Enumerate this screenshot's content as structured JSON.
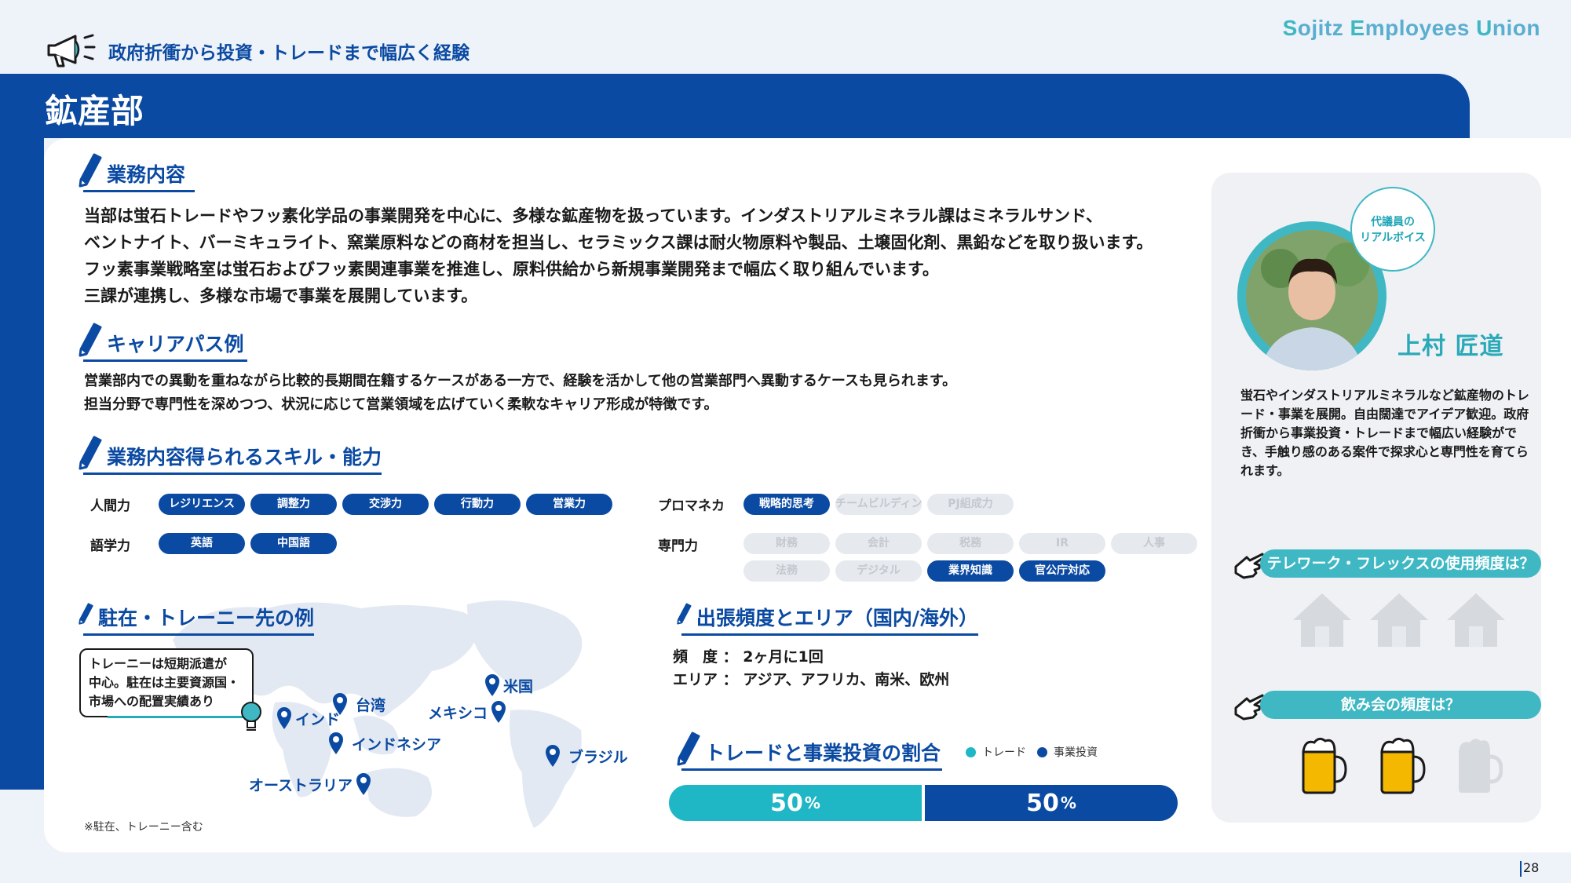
{
  "header": {
    "brand": [
      "S",
      "ojitz ",
      "E",
      "mployees ",
      "U",
      "nion"
    ],
    "tagline": "政府折衝から投資・トレードまで幅広く経験",
    "department": "鉱産部"
  },
  "colors": {
    "primary": "#0b4aa2",
    "accent": "#3fb8c4",
    "trade": "#1fb6c6",
    "invest": "#0b4aa2"
  },
  "business": {
    "title": "業務内容",
    "lines": [
      "当部は蛍石トレードやフッ素化学品の事業開発を中心に、多様な鉱産物を扱っています。インダストリアルミネラル課はミネラルサンド、",
      "ベントナイト、バーミキュライト、窯業原料などの商材を担当し、セラミックス課は耐火物原料や製品、土壌固化剤、黒鉛などを取り扱います。",
      "フッ素事業戦略室は蛍石およびフッ素関連事業を推進し、原料供給から新規事業開発まで幅広く取り組んでいます。",
      "三課が連携し、多様な市場で事業を展開しています。"
    ]
  },
  "career": {
    "title": "キャリアパス例",
    "lines": [
      "営業部内での異動を重ねながら比較的長期間在籍するケースがある一方で、経験を活かして他の営業部門へ異動するケースも見られます。",
      "担当分野で専門性を深めつつ、状況に応じて営業領域を広げていく柔軟なキャリア形成が特徴です。"
    ]
  },
  "skills": {
    "title": "業務内容得られるスキル・能力",
    "groups": [
      {
        "label": "人間力",
        "items": [
          {
            "name": "レジリエンス",
            "active": true
          },
          {
            "name": "調整力",
            "active": true
          },
          {
            "name": "交渉力",
            "active": true
          },
          {
            "name": "行動力",
            "active": true
          },
          {
            "name": "営業力",
            "active": true
          }
        ]
      },
      {
        "label": "語学力",
        "items": [
          {
            "name": "英語",
            "active": true
          },
          {
            "name": "中国語",
            "active": true
          }
        ]
      },
      {
        "label": "プロマネカ",
        "items": [
          {
            "name": "戦略的思考",
            "active": true
          },
          {
            "name": "チームビルディング",
            "active": false
          },
          {
            "name": "PJ組成力",
            "active": false
          }
        ]
      },
      {
        "label": "専門力",
        "items": [
          {
            "name": "財務",
            "active": false
          },
          {
            "name": "会計",
            "active": false
          },
          {
            "name": "税務",
            "active": false
          },
          {
            "name": "IR",
            "active": false
          },
          {
            "name": "人事",
            "active": false
          },
          {
            "name": "法務",
            "active": false
          },
          {
            "name": "デジタル",
            "active": false
          },
          {
            "name": "業界知識",
            "active": true
          },
          {
            "name": "官公庁対応",
            "active": true
          }
        ]
      }
    ]
  },
  "posting": {
    "title": "駐在・トレーニー先の例",
    "callout": [
      "トレーニーは短期派遣が",
      "中心。駐在は主要資源国・",
      "市場への配置実績あり"
    ],
    "places": [
      "インド",
      "台湾",
      "インドネシア",
      "オーストラリア",
      "メキシコ",
      "米国",
      "ブラジル"
    ],
    "note": "※駐在、トレーニー含む"
  },
  "trips": {
    "title": "出張頻度とエリア（国内/海外）",
    "frequency_label": "頻　度",
    "frequency": "2ヶ月に1回",
    "area_label": "エリア",
    "area": "アジア、アフリカ、南米、欧州"
  },
  "ratio": {
    "title": "トレードと事業投資の割合",
    "legend_trade": "トレード",
    "legend_invest": "事業投資",
    "trade_value": "50",
    "invest_value": "50",
    "unit": "%"
  },
  "side": {
    "voice": [
      "代議員の",
      "リアルボイス"
    ],
    "name": "上村 匠道",
    "comment": "蛍石やインダストリアルミネラルなど鉱産物のトレード・事業を展開。自由闊達でアイデア歓迎。政府折衝から事業投資・トレードまで幅広い経験ができ、手触り感のある案件で探求心と専門性を育てられます。",
    "telework_q": "テレワーク・フレックスの使用頻度は？",
    "telework_level": 0,
    "drinking_q": "飲み会の頻度は？",
    "drinking_level": 2,
    "drinking_max": 3
  },
  "page": "28"
}
